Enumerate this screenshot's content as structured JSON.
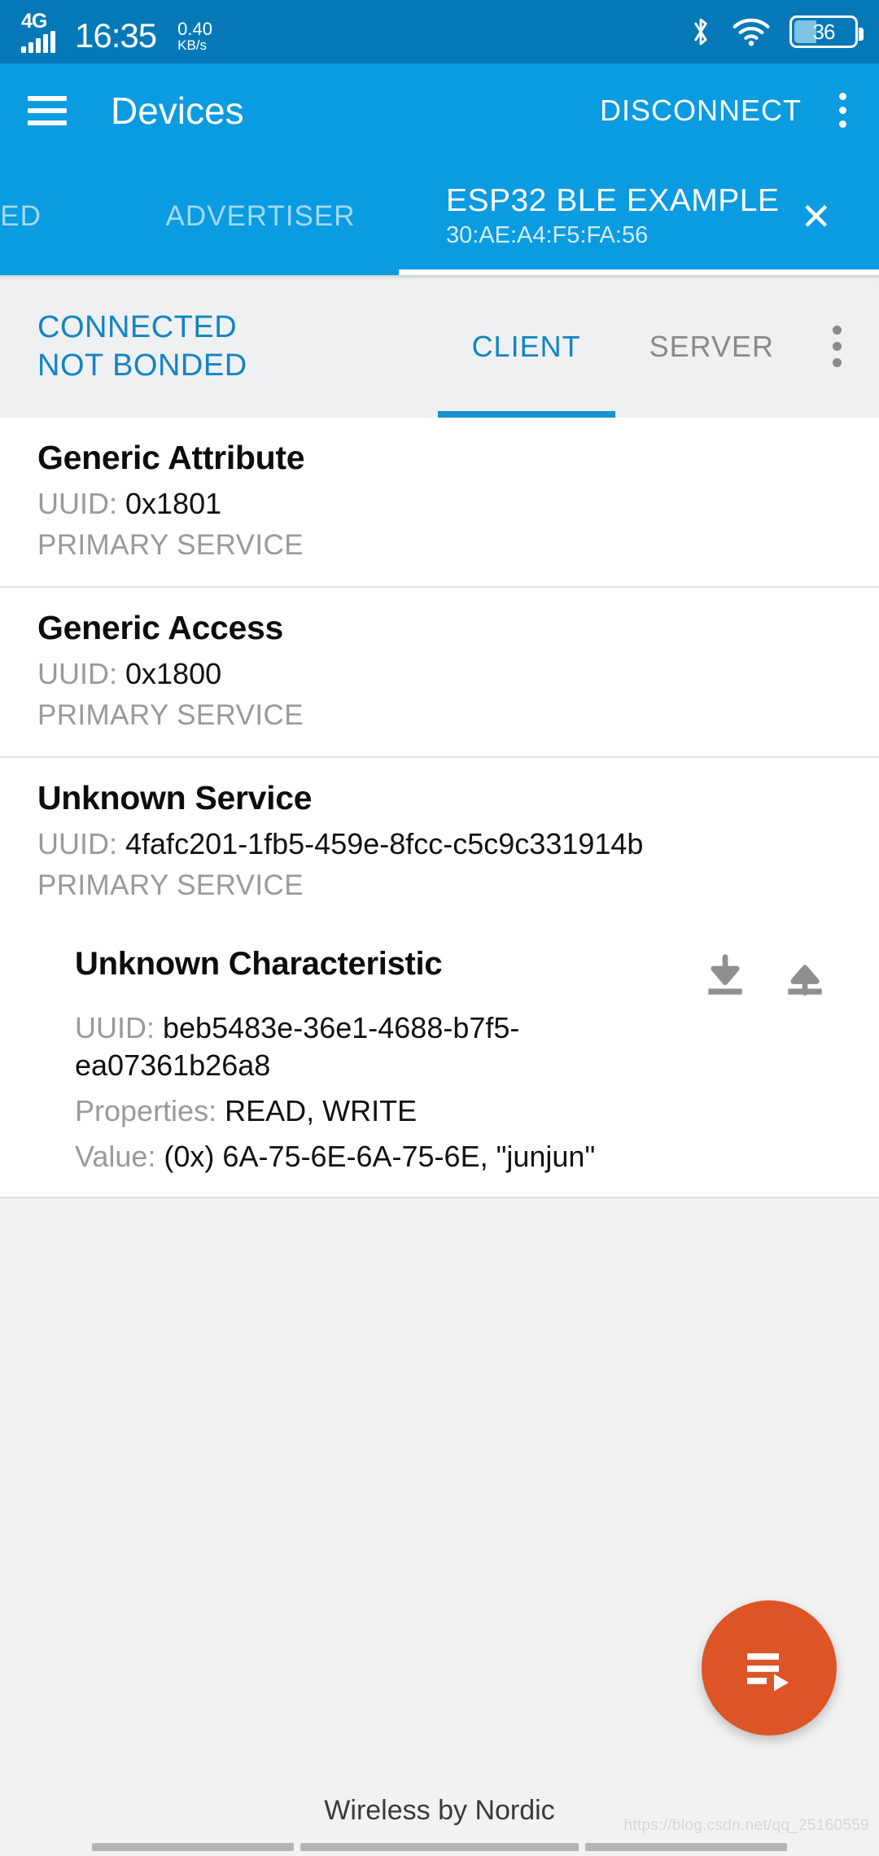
{
  "status_bar": {
    "network_type": "4G",
    "time": "16:35",
    "net_speed_value": "0.40",
    "net_speed_unit": "KB/s",
    "bluetooth_icon": "bluetooth-icon",
    "wifi_icon": "wifi-icon",
    "battery_percent": "36"
  },
  "app_bar": {
    "menu_icon": "hamburger-menu-icon",
    "title": "Devices",
    "disconnect_label": "DISCONNECT",
    "overflow_icon": "overflow-menu-icon"
  },
  "device_tabs": {
    "tabs": [
      {
        "label": "DED",
        "active": false
      },
      {
        "label": "ADVERTISER",
        "active": false
      }
    ],
    "active_tab": {
      "label": "ESP32 BLE EXAMPLE",
      "address": "30:AE:A4:F5:FA:56",
      "close_icon": "close-icon",
      "close_glyph": "✕"
    }
  },
  "connection": {
    "state_line1": "CONNECTED",
    "state_line2": "NOT BONDED",
    "tabs": [
      {
        "label": "CLIENT",
        "active": true
      },
      {
        "label": "SERVER",
        "active": false
      }
    ],
    "overflow_icon": "overflow-menu-icon"
  },
  "services": [
    {
      "name": "Generic Attribute",
      "uuid_label": "UUID:",
      "uuid": "0x1801",
      "type": "PRIMARY SERVICE"
    },
    {
      "name": "Generic Access",
      "uuid_label": "UUID:",
      "uuid": "0x1800",
      "type": "PRIMARY SERVICE"
    },
    {
      "name": "Unknown Service",
      "uuid_label": "UUID:",
      "uuid": "4fafc201-1fb5-459e-8fcc-c5c9c331914b",
      "type": "PRIMARY SERVICE"
    }
  ],
  "characteristic": {
    "name": "Unknown Characteristic",
    "uuid_label": "UUID:",
    "uuid": "beb5483e-36e1-4688-b7f5-ea07361b26a8",
    "properties_label": "Properties:",
    "properties": "READ, WRITE",
    "value_label": "Value:",
    "value": "(0x) 6A-75-6E-6A-75-6E, \"junjun\"",
    "read_icon": "download-read-icon",
    "write_icon": "upload-write-icon"
  },
  "fab": {
    "icon": "playlist-play-icon"
  },
  "footer": {
    "text": "Wireless by Nordic",
    "watermark": "https://blog.csdn.net/qq_25160559"
  },
  "colors": {
    "status_bar_blue": "#0579b8",
    "app_bar_blue": "#0a9be0",
    "accent_blue": "#1284c4",
    "fab_orange": "#dd5427",
    "muted_gray": "#9a9a9a"
  }
}
